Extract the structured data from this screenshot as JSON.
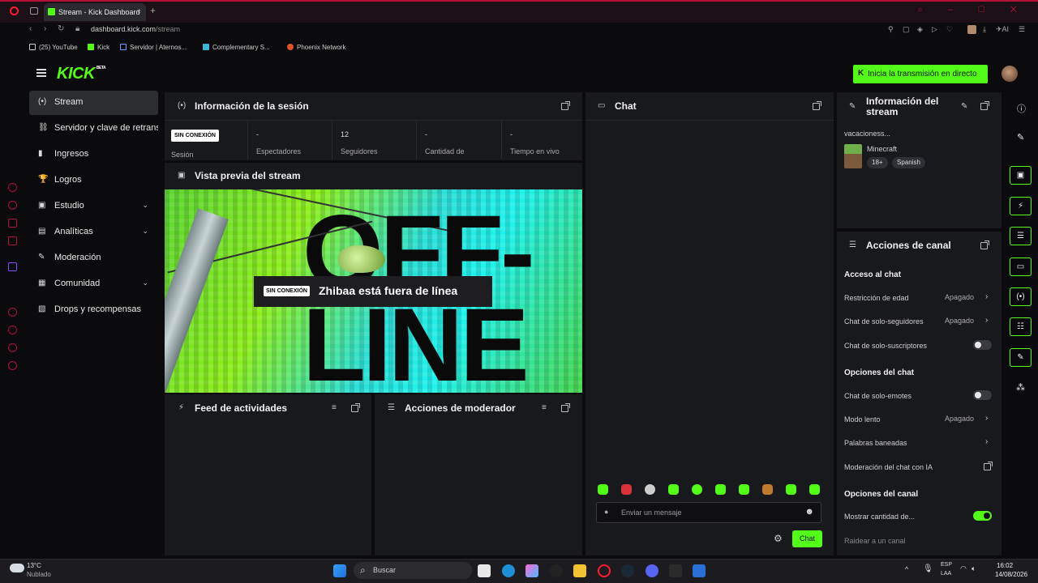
{
  "browser": {
    "tab_title": "Stream - Kick Dashboard",
    "new_tab": "+",
    "url_host": "dashboard.kick.com",
    "url_path": "/stream",
    "ai_label": "AI",
    "bookmarks": [
      "(25) YouTube",
      "Kick",
      "Servidor | Aternos...",
      "Complementary S...",
      "Phoenix Network"
    ]
  },
  "header": {
    "logo": "KICK",
    "logo_tag": "BETA",
    "go_live_label": "Inicia la transmisión en directo"
  },
  "nav": {
    "items": [
      {
        "label": "Stream",
        "icon": "broadcast-icon",
        "glyph": "(•)"
      },
      {
        "label": "Servidor y clave de retransmisión",
        "icon": "link-icon",
        "glyph": "⛓"
      },
      {
        "label": "Ingresos",
        "icon": "bar-chart-icon",
        "glyph": "▮"
      },
      {
        "label": "Logros",
        "icon": "trophy-icon",
        "glyph": "🏆"
      },
      {
        "label": "Estudio",
        "icon": "studio-icon",
        "glyph": "▣",
        "chevron": "⌄"
      },
      {
        "label": "Analíticas",
        "icon": "analytics-icon",
        "glyph": "▤",
        "chevron": "⌄"
      },
      {
        "label": "Moderación",
        "icon": "wrench-icon",
        "glyph": "✎"
      },
      {
        "label": "Comunidad",
        "icon": "community-icon",
        "glyph": "▦",
        "chevron": "⌄"
      },
      {
        "label": "Drops y recompensas",
        "icon": "gift-icon",
        "glyph": "▧"
      }
    ]
  },
  "session": {
    "title": "Información de la sesión",
    "offline_badge": "SIN CONEXIÓN",
    "session_label": "Sesión",
    "stats": [
      {
        "value": "-",
        "label": "Espectadores"
      },
      {
        "value": "12",
        "label": "Seguidores"
      },
      {
        "value": "-",
        "label": "Cantidad de"
      },
      {
        "value": "-",
        "label": "Tiempo en vivo"
      }
    ]
  },
  "preview": {
    "title": "Vista previa del stream",
    "background_text": "OFF-\nLINE",
    "offline_badge": "SIN CONEXIÓN",
    "offline_message": "Zhibaa está fuera de línea"
  },
  "activity_feed": {
    "title": "Feed de actividades"
  },
  "mod_actions": {
    "title": "Acciones de moderador"
  },
  "chat": {
    "title": "Chat",
    "input_placeholder": "Enviar un mensaje",
    "send_label": "Chat"
  },
  "stream_info": {
    "title_line1": "Información del",
    "title_line2": "stream",
    "stream_title": "vacacioness...",
    "category": "Minecraft",
    "tags": [
      "18+",
      "Spanish"
    ]
  },
  "channel_actions": {
    "title": "Acciones de canal",
    "sections": {
      "chat_access": "Acceso al chat",
      "chat_options": "Opciones del chat",
      "channel_options": "Opciones del canal"
    },
    "rows": {
      "age_restriction": {
        "label": "Restricción de edad",
        "value": "Apagado"
      },
      "followers_only": {
        "label": "Chat de solo-seguidores",
        "value": "Apagado"
      },
      "subscribers_only": {
        "label": "Chat de solo-suscriptores",
        "on": false
      },
      "emotes_only": {
        "label": "Chat de solo-emotes",
        "on": false
      },
      "slow_mode": {
        "label": "Modo lento",
        "value": "Apagado"
      },
      "banned_words": {
        "label": "Palabras baneadas"
      },
      "ai_moderation": {
        "label": "Moderación del chat con IA"
      },
      "show_count": {
        "label": "Mostrar cantidad de...",
        "on": true
      },
      "raid": {
        "label": "Raidear a un canal"
      }
    }
  },
  "taskbar": {
    "weather_temp": "13°C",
    "weather_desc": "Nublado",
    "search_placeholder": "Buscar",
    "lang_top": "ESP",
    "lang_bottom": "LAA",
    "time": "16:02",
    "date": "14/08/2026"
  },
  "colors": {
    "accent": "#53fc18",
    "panel": "#18191c",
    "background": "#0b0b0d",
    "opera_red": "#b0123a"
  }
}
